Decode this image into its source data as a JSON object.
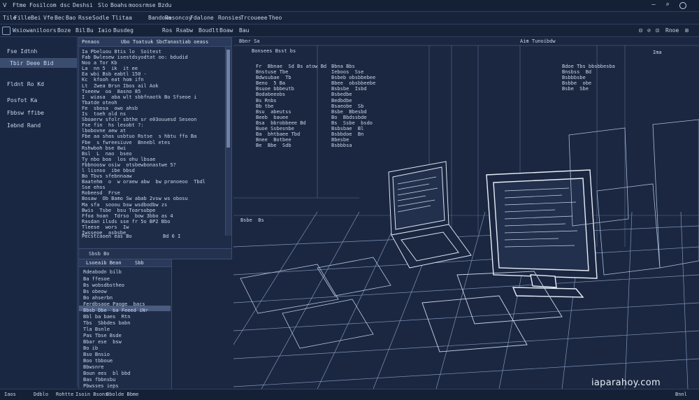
{
  "titlebar": {
    "items": [
      "ᐯ",
      "Ftme",
      "Fosilcom",
      "dsc",
      "Deshsi",
      "Slo",
      "Boahs",
      "moosrmse",
      "Bzdu"
    ],
    "controls": [
      "—",
      "⌕",
      "□"
    ]
  },
  "menubar": {
    "items": [
      "Tile",
      "Fille",
      "Bei",
      "Vfe",
      "Bec",
      "Bao",
      "Rsse",
      "Sodle",
      "Tlitaa",
      "Bandowe",
      "Rasoncoy",
      "Fdalone",
      "Ronsies",
      "Trcoueee",
      "Theo"
    ]
  },
  "toolbar": {
    "items": [
      "Wsiowaniloors",
      "Boze",
      "Bil",
      "Bu",
      "Iaio",
      "Busdeg",
      "Ros",
      "Rsabw",
      "Boudlt",
      "Boaw",
      "Bau"
    ],
    "right_items": [
      "⊟",
      "⊘",
      "⊡",
      "Rnoe",
      "⊞"
    ]
  },
  "sidebar": {
    "header": "Fse Idtnh",
    "items": [
      "Tbir Deee Bid",
      "Fldnt Ro Kd",
      "Posfot Ka",
      "Fbbsw ffibe",
      "Iebnd Rand"
    ],
    "selected_index": 0
  },
  "editor": {
    "tab1": "Pnnaos",
    "tab2": "Ubo Toatsuk Sbc",
    "tab3": "Tanastiab oeass",
    "lines": [
      "Ia Pbeluou 8tis lo  Soitest",
      "Fab Bwlesew isestdsyodtat oo: bdudid",
      "Noo a Tor Kb",
      "La  nn 5  ik  it ee",
      "Ea wbi Bsb eabtl 150 -",
      "Kc  kfooh eat hom ifn",
      "Lt  Zwea Brsn Ibos ail Aok",
      "Tseeew  oa  8asno 85",
      "I  wiasa  aba wlt sbbfnaotk Bo Sfseoe i",
      "Tbatde oteoh",
      "Fe  sbosa  owo ahsb",
      "Is  toeh ald ns",
      "Sboaerw sfolr sbthe sr e03ouuesd Seseon",
      "Fse fin  hs lesobt ?:",
      "lbobovne aew at",
      "Fbe aa shas usbtuo Rstse  s hbtu ffo Ba",
      "Fbe  s fwreesiuve  Bnnebl etes",
      "Rshwboh bse 8wi",
      "Bsl  L  nao  bseo",
      "Ty nbo boa  los ohu lbsae",
      "Fbbnoosw osiw  otsbewbonastwe 5?",
      "l lisnso  ibe bbsd",
      "Bo Tbvs sfebnnaaw",
      "Baatehm  o  w oraew abw  bw pranoeoo  Tbdl",
      "Sse ehss",
      "Robeesd  Frse",
      "Bosaw  Ob Bamo Sw abab 2vsw ws obosu",
      "Ma sfa  sooou bsw wsdbodbw zs",
      "Bwis  Tsbe  bsu Toarsubpe",
      "Ffoa hoan  Tdrso  bow 3bbo as 4",
      "Rasdan ilsds sse fr 5o BP2 Bbo",
      "Tleese  wors  Iw",
      "Iwsseoe  asbsbe"
    ],
    "footer_left": "Pecstcaoen eas Bo",
    "footer_right": "Bd 6 I"
  },
  "lower_panel": {
    "header": "Lsoeaib Bean",
    "header_right": "Sbb",
    "tab": "Rdeabodn bilb",
    "items": [
      "Ba ffesoe",
      "Bs wobsdbstheo",
      "Bs obeow",
      "Bo ahserbn",
      "Ferdbsaoe Paoge  bacs",
      "Bbsb Dbe  ba Feeed iNr",
      "Bbl ba baes  Rtn",
      "Tbs  Sbbdes babn",
      "Tla Bsnle",
      "Pas Tbse Bsde",
      "Bbar ese  bsw",
      "Bo ib",
      "Bso Bnsio",
      "Boo tbboue",
      "Bbwsnre",
      "Boun ees  bl bbd",
      "Bas fbbnsbu",
      "Pbwsses ieps"
    ],
    "selected_index": 4
  },
  "canvas": {
    "header_left": "Bbnr Sa",
    "header_mid": "Aim Tunoibdw",
    "header_right": "Ima",
    "title_block": "Bonsees Bsst bs",
    "code_left": [
      "Fr  Bbnae  Sd Bs atow Bd",
      "Bnstuse Tbe",
      "Bdwsubae  Tb",
      "Beno  5 Ba",
      "Bsuoe bbbeutb",
      "Bodabeeobs",
      "Bs Rnbs",
      "Bb tbe",
      "Bsu  abeutss",
      "Beeb  bauee",
      "Bsa  bbrobbeee Bd",
      "Buoe Ssbesnbe",
      "Ba  bhtbaee Tbd",
      "Bnee  Botbee",
      "Be  Bbe  Sdb"
    ],
    "code_mid": [
      "Bbna Bbs",
      "Ieboos  Sse",
      "Bsbeb obsbbebee",
      "Bbee  obsbbeebe",
      "Bsbsbe  Isbd",
      "Bsbedbe",
      "Bedbdbe",
      "Bsaeobe  Sb",
      "Bsbe  Bbesbd",
      "Bo  Bbdssbde",
      "Bs  Ssbe  bsdo",
      "Bsbsbae  Bl",
      "Bsbbdoe  Bn",
      "Bbesbe",
      "Bsbbbsa"
    ],
    "code_right": [
      "Bdoe Tbs bbsbbesba",
      "Bnsbss  Bd",
      "Bsbbbsbe",
      "Bsbbe  obe",
      "Bsbe  Sbe"
    ],
    "sub_header": "Bsbe  Bs",
    "footer_label": "Sbsb Bo"
  },
  "statusbar": {
    "items": [
      "Iaos",
      "Ddblo",
      "Rohtte",
      "Isoin Bsons",
      "Bbolde Bbme"
    ],
    "right": "Bnnl"
  },
  "watermark": "iaparahoy.com"
}
